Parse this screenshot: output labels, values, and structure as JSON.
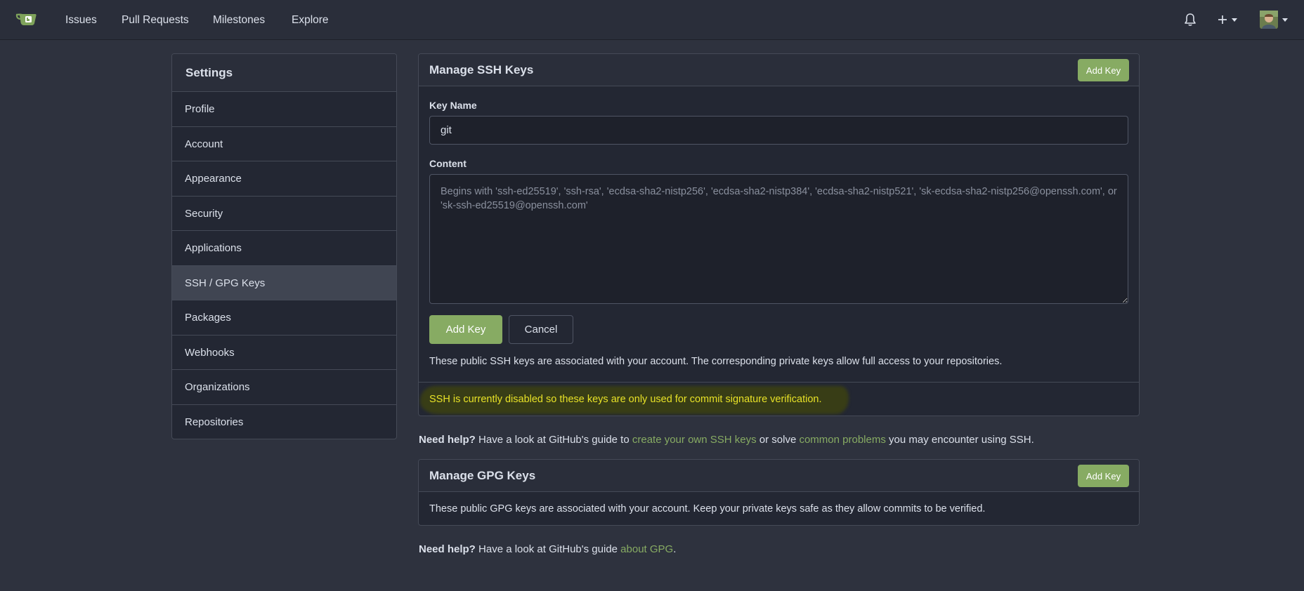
{
  "navbar": {
    "links": [
      "Issues",
      "Pull Requests",
      "Milestones",
      "Explore"
    ],
    "icons": {
      "logo": "gitea-teacup-logo",
      "notifications": "bell-icon",
      "create": "plus-icon",
      "avatar": "user-avatar"
    }
  },
  "sidebar": {
    "title": "Settings",
    "items": [
      {
        "label": "Profile"
      },
      {
        "label": "Account"
      },
      {
        "label": "Appearance"
      },
      {
        "label": "Security"
      },
      {
        "label": "Applications"
      },
      {
        "label": "SSH / GPG Keys",
        "active": true
      },
      {
        "label": "Packages"
      },
      {
        "label": "Webhooks"
      },
      {
        "label": "Organizations"
      },
      {
        "label": "Repositories"
      }
    ]
  },
  "ssh": {
    "title": "Manage SSH Keys",
    "add_key_label": "Add Key",
    "key_name_label": "Key Name",
    "key_name_value": "git",
    "content_label": "Content",
    "content_placeholder": "Begins with 'ssh-ed25519', 'ssh-rsa', 'ecdsa-sha2-nistp256', 'ecdsa-sha2-nistp384', 'ecdsa-sha2-nistp521', 'sk-ecdsa-sha2-nistp256@openssh.com', or 'sk-ssh-ed25519@openssh.com'",
    "submit_label": "Add Key",
    "cancel_label": "Cancel",
    "description": "These public SSH keys are associated with your account. The corresponding private keys allow full access to your repositories.",
    "warning": "SSH is currently disabled so these keys are only used for commit signature verification."
  },
  "ssh_help": {
    "bold": "Need help?",
    "text1": " Have a look at GitHub's guide to ",
    "link1": "create your own SSH keys",
    "text2": " or solve ",
    "link2": "common problems",
    "text3": " you may encounter using SSH."
  },
  "gpg": {
    "title": "Manage GPG Keys",
    "add_key_label": "Add Key",
    "description": "These public GPG keys are associated with your account. Keep your private keys safe as they allow commits to be verified."
  },
  "gpg_help": {
    "bold": "Need help?",
    "text1": " Have a look at GitHub's guide ",
    "link1": "about GPG",
    "text2": "."
  },
  "colors": {
    "accent": "#87ab63",
    "warning": "#e8e227",
    "background": "#2e323e"
  }
}
